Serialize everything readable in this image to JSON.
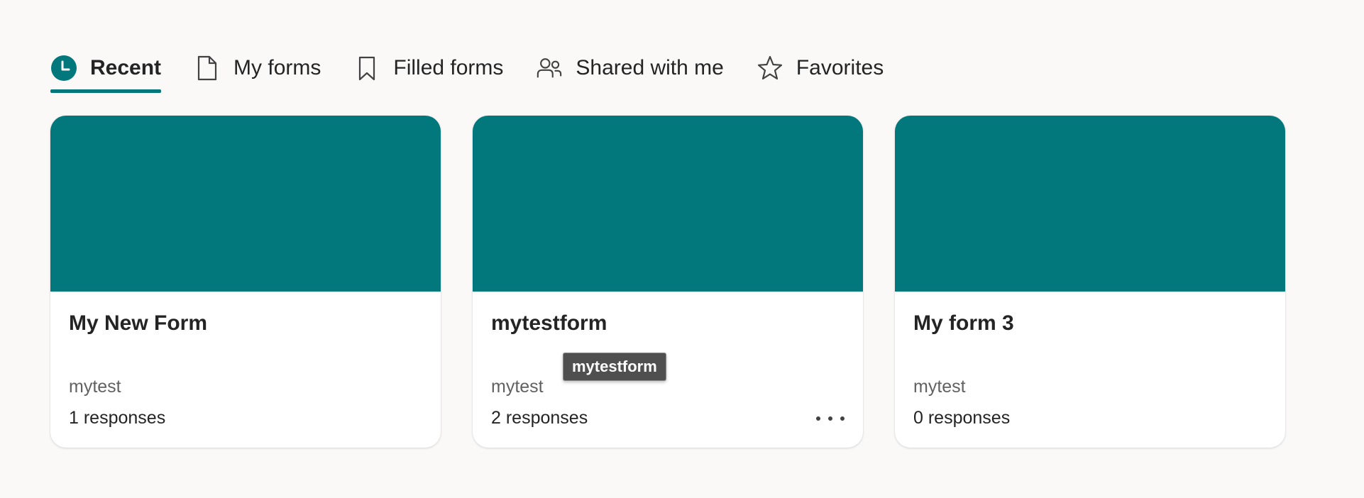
{
  "colors": {
    "accent": "#03787c",
    "background": "#faf9f8",
    "card": "#ffffff",
    "text": "#242424",
    "muted_text": "#616161",
    "tooltip_bg": "#4f4f4f"
  },
  "tabs": [
    {
      "label": "Recent",
      "icon": "clock-icon",
      "active": true
    },
    {
      "label": "My forms",
      "icon": "document-icon",
      "active": false
    },
    {
      "label": "Filled forms",
      "icon": "bookmark-icon",
      "active": false
    },
    {
      "label": "Shared with me",
      "icon": "people-icon",
      "active": false
    },
    {
      "label": "Favorites",
      "icon": "star-icon",
      "active": false
    }
  ],
  "cards": [
    {
      "title": "My New Form",
      "owner": "mytest",
      "responses": "1 responses"
    },
    {
      "title": "mytestform",
      "owner": "mytest",
      "responses": "2 responses",
      "more_icon": "more-horizontal-icon",
      "tooltip": "mytestform"
    },
    {
      "title": "My form 3",
      "owner": "mytest",
      "responses": "0 responses"
    }
  ]
}
